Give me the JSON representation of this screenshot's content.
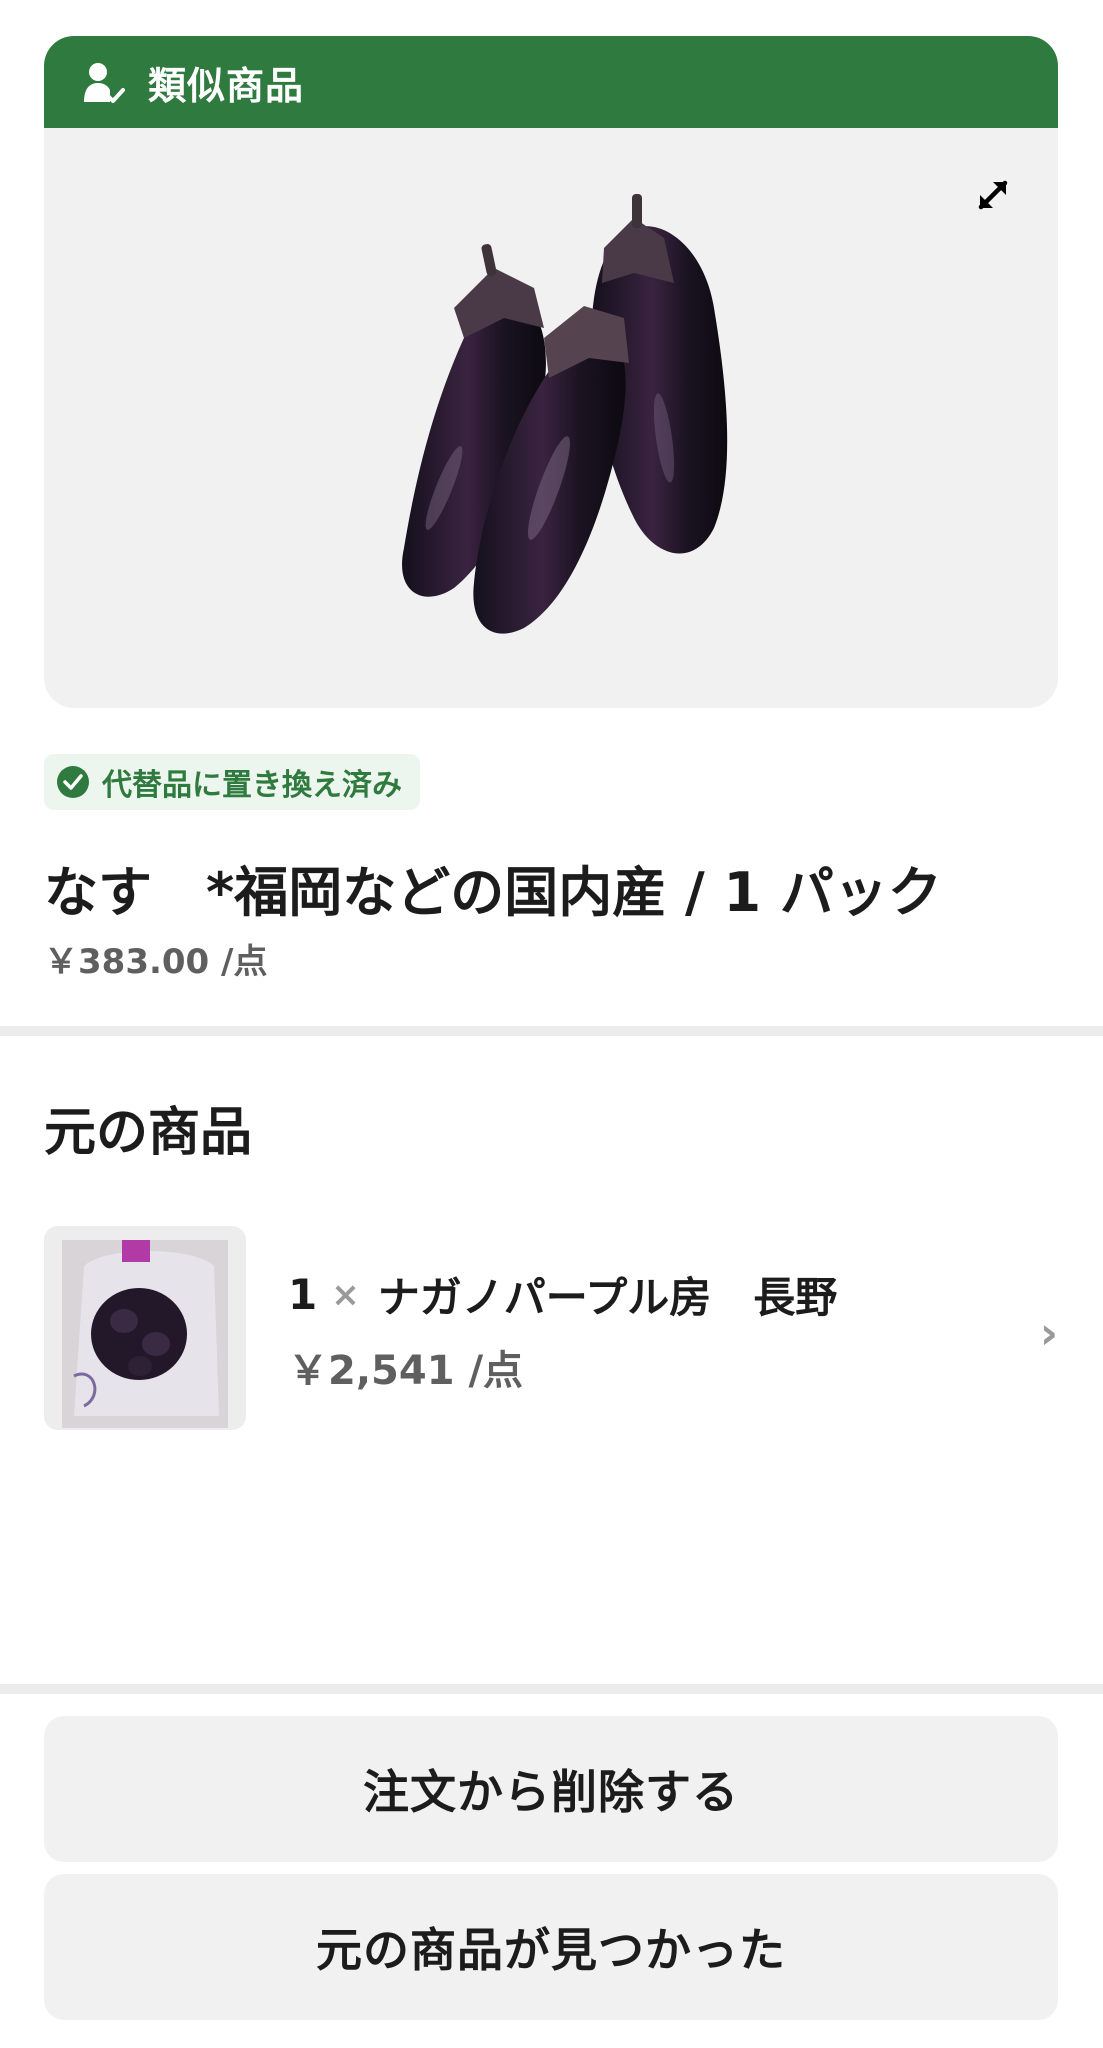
{
  "similar_card": {
    "header_title": "類似商品",
    "header_icon": "person-check-icon",
    "expand_icon": "expand-icon",
    "image_alt": "eggplant"
  },
  "badge": {
    "label": "代替品に置き換え済み",
    "icon": "check-circle-icon"
  },
  "product": {
    "name": "なす　*福岡などの国内産 / 1 パック",
    "price": "￥383.00 /点"
  },
  "original": {
    "section_title": "元の商品",
    "quantity": "1",
    "times": "×",
    "name": "ナガノパープル房　長野",
    "price": "￥2,541 /点",
    "chevron": "›"
  },
  "buttons": {
    "remove": "注文から削除する",
    "found": "元の商品が見つかった"
  },
  "colors": {
    "accent_green": "#2f7a3f",
    "badge_bg": "#edf6ee",
    "button_bg": "#f1f1f1"
  }
}
